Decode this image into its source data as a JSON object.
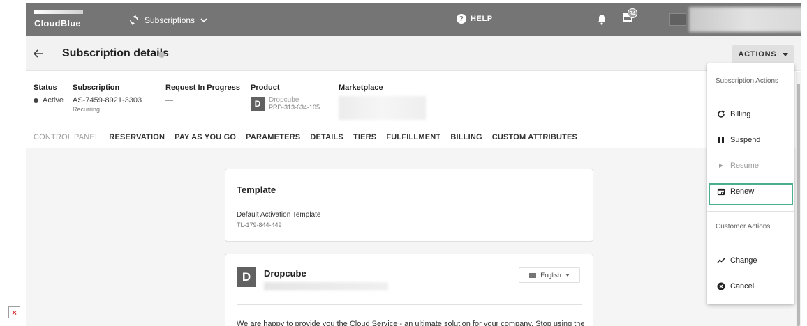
{
  "app": {
    "brand": "CloudBlue",
    "module_label": "Subscriptions",
    "help_label": "HELP",
    "notification_count": "34"
  },
  "page": {
    "title": "Subscription details",
    "actions_label": "ACTIONS"
  },
  "details": {
    "status": {
      "label": "Status",
      "value": "Active"
    },
    "subscription": {
      "label": "Subscription",
      "value": "AS-7459-8921-3303",
      "sub": "Recurring"
    },
    "request": {
      "label": "Request In Progress",
      "value": "—"
    },
    "product": {
      "label": "Product",
      "logo_letter": "D",
      "name": "Dropcube",
      "id": "PRD-313-634-105"
    },
    "marketplace": {
      "label": "Marketplace"
    }
  },
  "tabs": [
    {
      "label": "CONTROL PANEL",
      "active": true
    },
    {
      "label": "RESERVATION"
    },
    {
      "label": "PAY AS YOU GO"
    },
    {
      "label": "PARAMETERS"
    },
    {
      "label": "DETAILS"
    },
    {
      "label": "TIERS"
    },
    {
      "label": "FULFILLMENT"
    },
    {
      "label": "BILLING"
    },
    {
      "label": "CUSTOM ATTRIBUTES"
    }
  ],
  "template_card": {
    "title": "Template",
    "name": "Default Activation Template",
    "id": "TL-179-844-449"
  },
  "product_card": {
    "logo_letter": "D",
    "name": "Dropcube",
    "language": "English",
    "text": "We are happy to provide you the Cloud Service - an ultimate solution for your company. Stop using the"
  },
  "menu": {
    "subscription_header": "Subscription Actions",
    "billing": "Billing",
    "suspend": "Suspend",
    "resume": "Resume",
    "renew": "Renew",
    "customer_header": "Customer Actions",
    "change": "Change",
    "cancel": "Cancel"
  },
  "colors": {
    "topbar": "#757575",
    "highlight": "#4caf8c"
  }
}
